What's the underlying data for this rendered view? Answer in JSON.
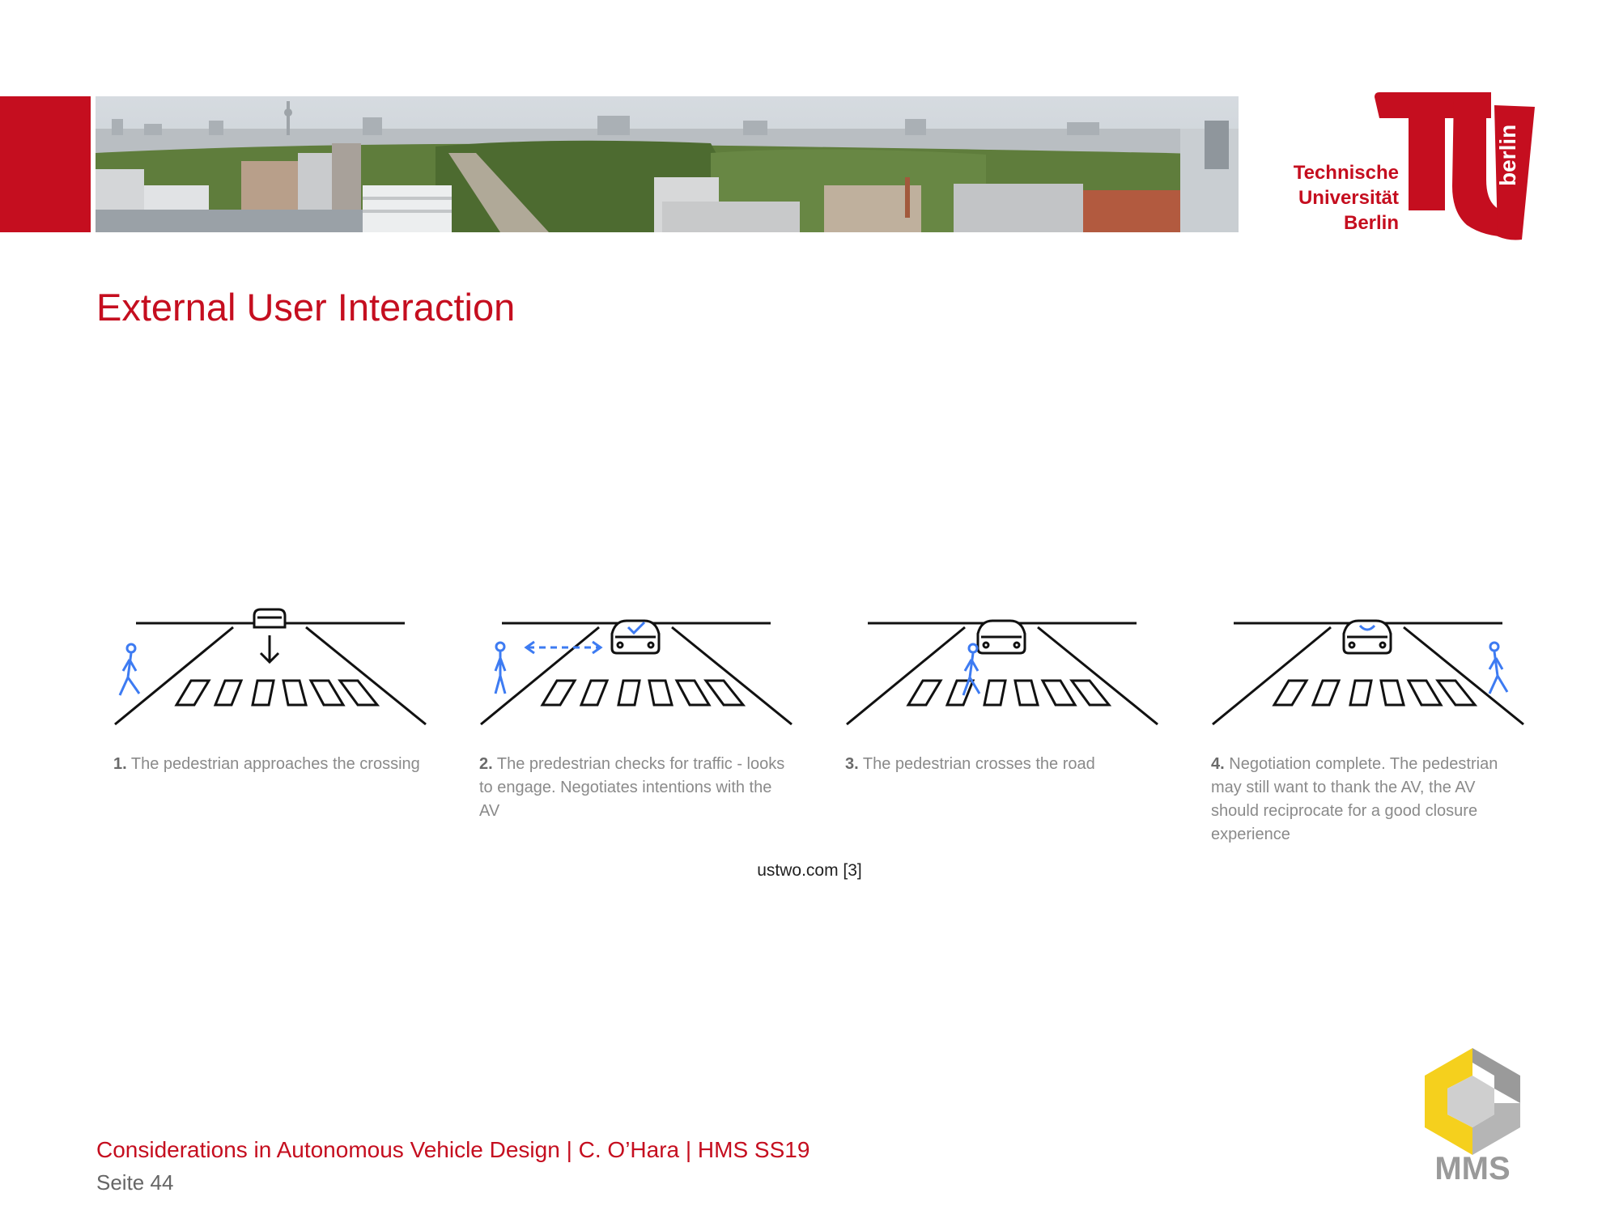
{
  "header": {
    "university_name_lines": [
      "Technische",
      "Universität",
      "Berlin"
    ],
    "logo_word": "berlin",
    "brand_color": "#c50e1f"
  },
  "slide": {
    "title": "External User Interaction"
  },
  "steps": [
    {
      "number": "1.",
      "text": "The pedestrian approaches the crossing"
    },
    {
      "number": "2.",
      "text": "The predestrian checks for traffic - looks to engage. Negotiates intentions with the AV"
    },
    {
      "number": "3.",
      "text": "The pedestrian crosses the road"
    },
    {
      "number": "4.",
      "text": "Negotiation complete. The pedestrian may still want to thank the AV, the AV should reciprocate for a good closure experience"
    }
  ],
  "source": "ustwo.com [3]",
  "footer": {
    "course": "Considerations in Autonomous Vehicle Design | C. O’Hara | HMS SS19",
    "page": "Seite 44",
    "mms_logo_text": "MMS"
  },
  "colors": {
    "pedestrian": "#3d7bf2",
    "caption": "#8a8a8a",
    "mms_yellow": "#f5d01d",
    "mms_grey": "#9a9a9a"
  }
}
